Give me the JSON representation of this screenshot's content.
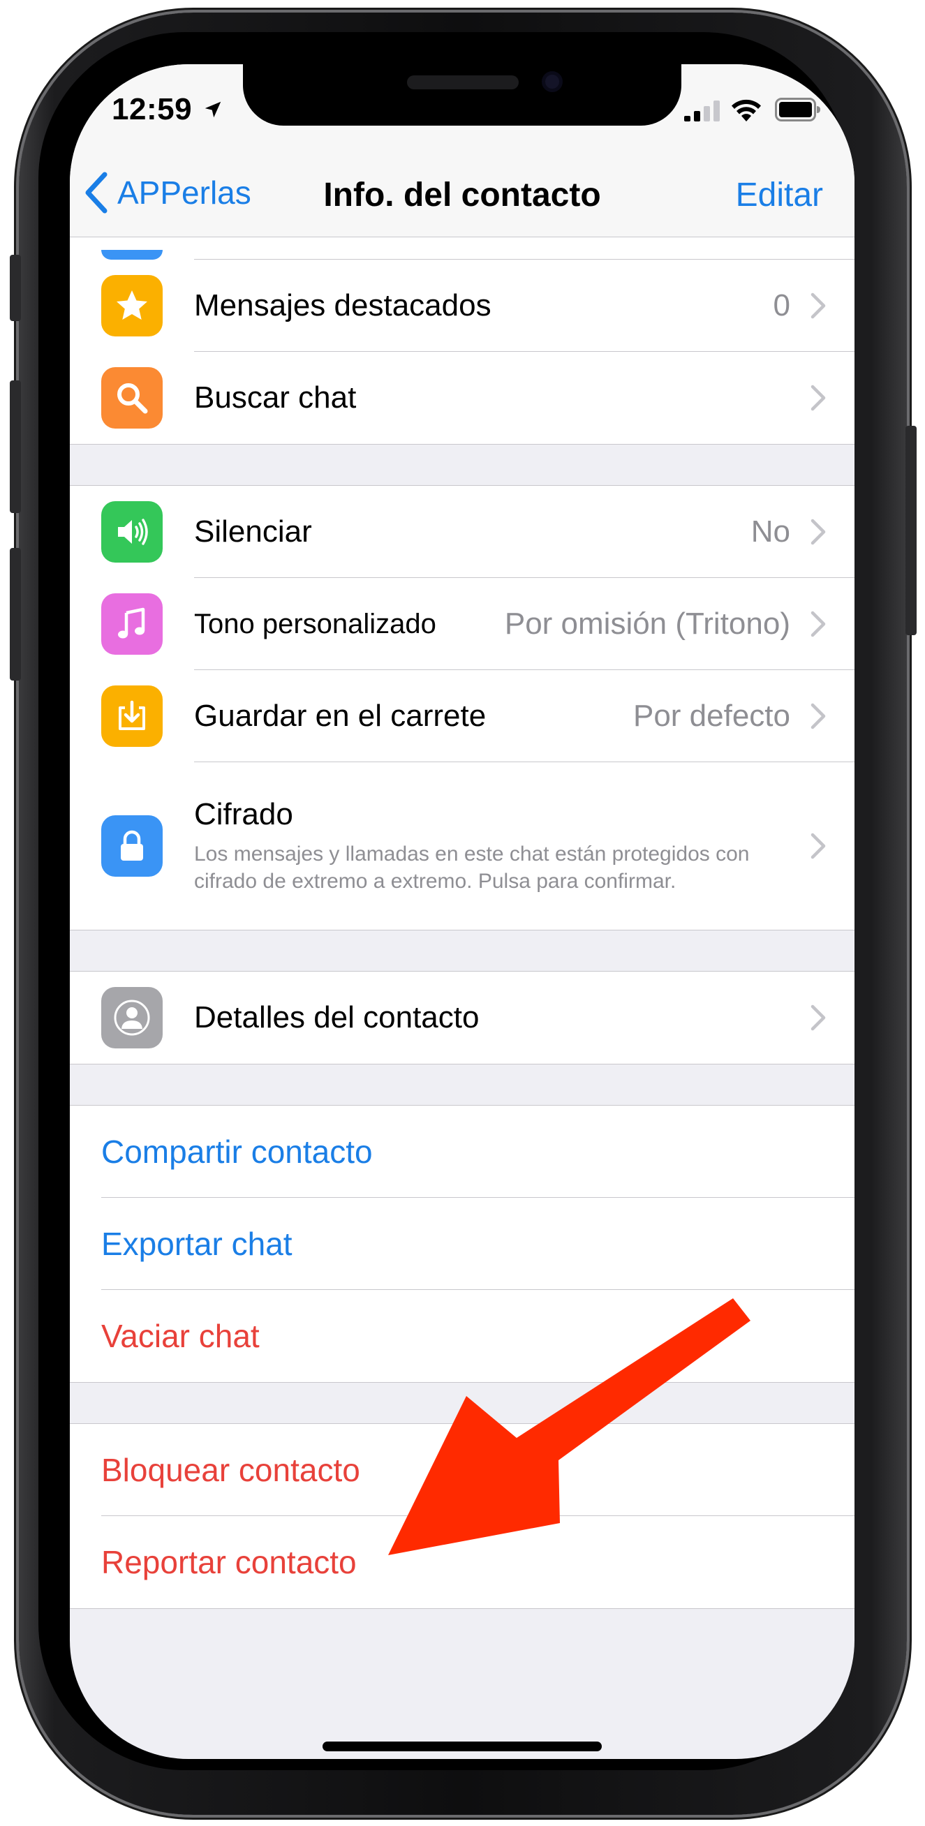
{
  "status_bar": {
    "time": "12:59"
  },
  "nav": {
    "back_label": "APPerlas",
    "title": "Info. del contacto",
    "edit_label": "Editar"
  },
  "group1": [
    {
      "icon": "star-icon",
      "color": "#fbb000",
      "label": "Mensajes destacados",
      "value": "0"
    },
    {
      "icon": "search-icon",
      "color": "#fb8a33",
      "label": "Buscar chat",
      "value": ""
    }
  ],
  "group2": [
    {
      "icon": "speaker-icon",
      "color": "#34c759",
      "label": "Silenciar",
      "value": "No"
    },
    {
      "icon": "music-note-icon",
      "color": "#e86ee0",
      "label": "Tono personalizado",
      "value": "Por omisión (Tritono)"
    },
    {
      "icon": "download-icon",
      "color": "#fbb000",
      "label": "Guardar en el carrete",
      "value": "Por defecto"
    }
  ],
  "encryption": {
    "icon": "lock-icon",
    "color": "#3a94f5",
    "title": "Cifrado",
    "description": "Los mensajes y llamadas en este chat están protegidos con cifrado de extremo a extremo. Pulsa para confirmar."
  },
  "contact_details": {
    "icon": "contact-icon",
    "color": "#a6a6aa",
    "label": "Detalles del contacto"
  },
  "actions1": [
    {
      "label": "Compartir contacto",
      "color": "#1a7ee6"
    },
    {
      "label": "Exportar chat",
      "color": "#1a7ee6"
    },
    {
      "label": "Vaciar chat",
      "color": "#e8413a"
    }
  ],
  "actions2": [
    {
      "label": "Bloquear contacto",
      "color": "#e8413a"
    },
    {
      "label": "Reportar contacto",
      "color": "#e8413a"
    }
  ],
  "annotation": {
    "arrow_color": "#ff2a00"
  }
}
